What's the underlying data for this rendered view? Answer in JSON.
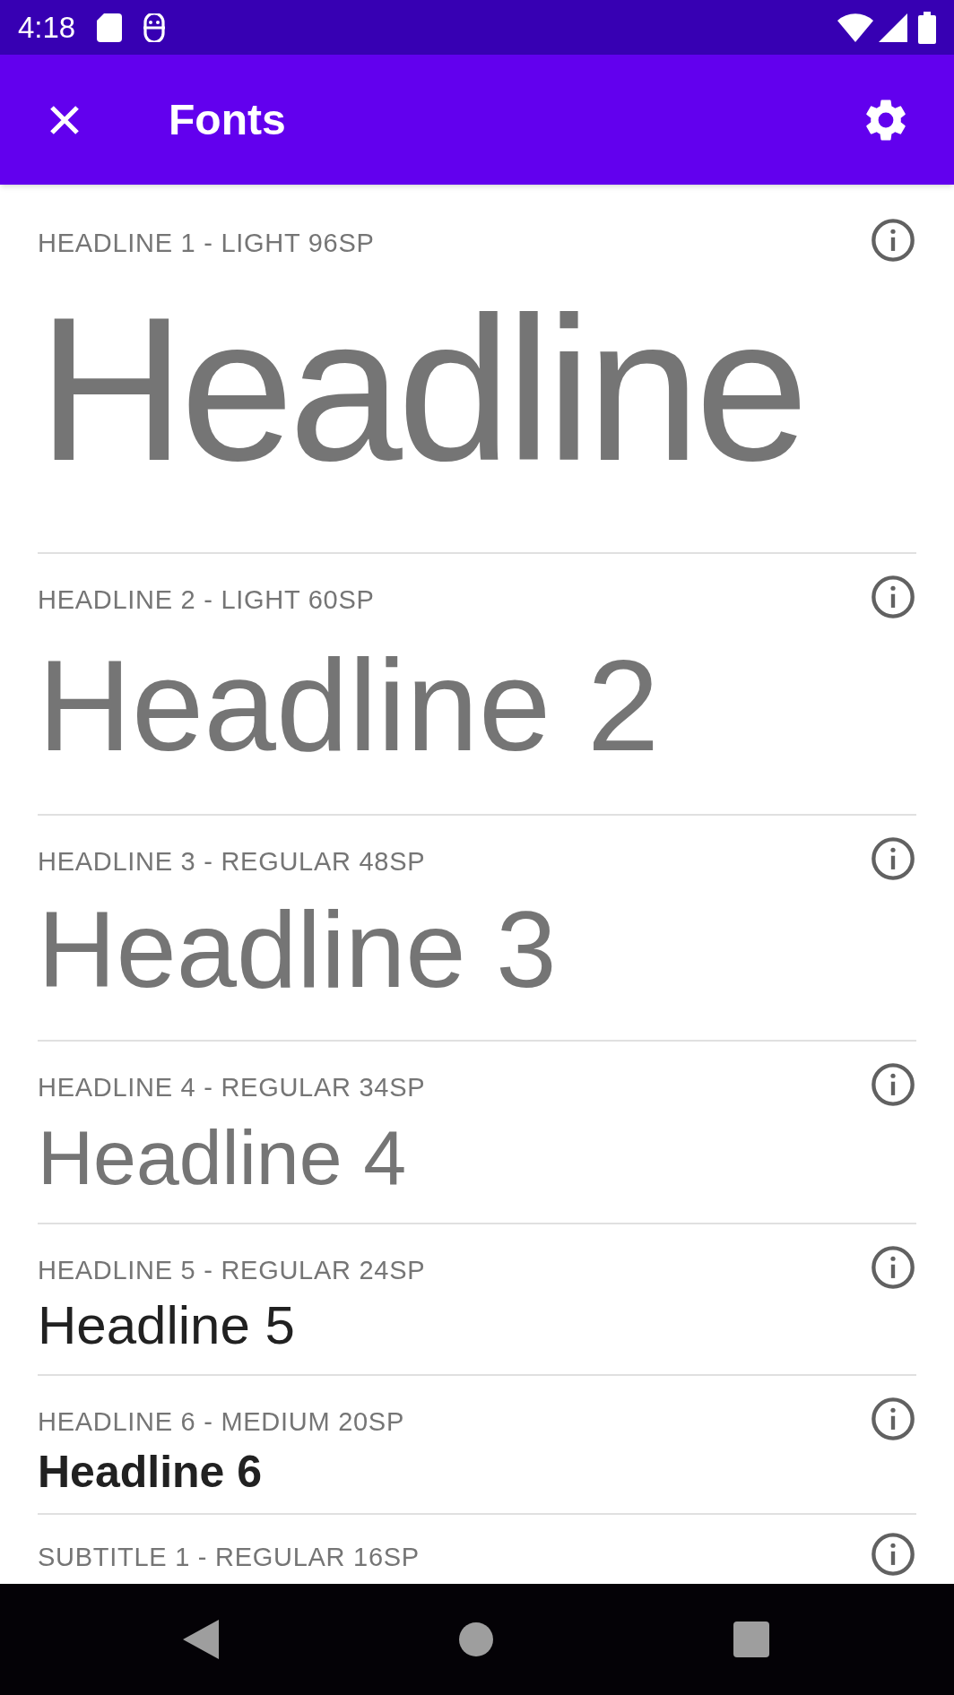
{
  "status_bar": {
    "time": "4:18"
  },
  "app_bar": {
    "title": "Fonts"
  },
  "rows": [
    {
      "label": "HEADLINE 1 - LIGHT 96SP",
      "sample": "Headline"
    },
    {
      "label": "HEADLINE 2 - LIGHT 60SP",
      "sample": "Headline 2"
    },
    {
      "label": "HEADLINE 3 - REGULAR 48SP",
      "sample": "Headline 3"
    },
    {
      "label": "HEADLINE 4 - REGULAR 34SP",
      "sample": "Headline 4"
    },
    {
      "label": "HEADLINE 5 - REGULAR 24SP",
      "sample": "Headline 5"
    },
    {
      "label": "HEADLINE 6 - MEDIUM 20SP",
      "sample": "Headline 6"
    },
    {
      "label": "SUBTITLE 1 - REGULAR 16SP"
    }
  ]
}
